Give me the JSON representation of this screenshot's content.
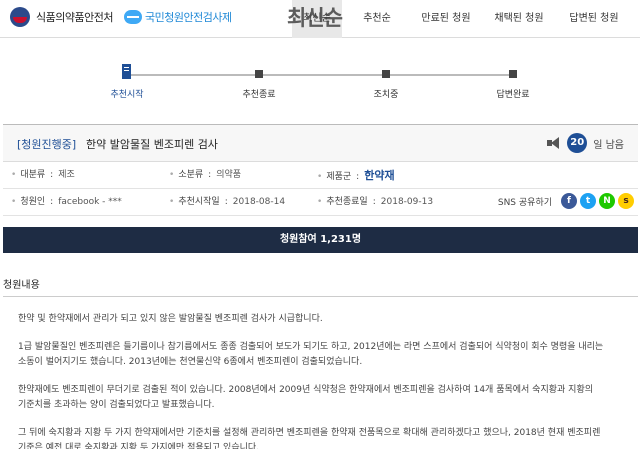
{
  "header": {
    "logo_text": "식품의약품안전처",
    "sub_logo_text": "국민청원안전검사제",
    "overlay_title": "최신순",
    "nav": [
      {
        "label": "최신순",
        "active": true
      },
      {
        "label": "추천순",
        "active": false
      },
      {
        "label": "만료된 청원",
        "active": false
      },
      {
        "label": "채택된 청원",
        "active": false
      },
      {
        "label": "답변된 청원",
        "active": false
      }
    ]
  },
  "progress": {
    "steps": [
      {
        "label": "추천시작",
        "current": true
      },
      {
        "label": "추천종료",
        "current": false
      },
      {
        "label": "조치중",
        "current": false
      },
      {
        "label": "답변완료",
        "current": false
      }
    ]
  },
  "petition": {
    "status": "[청원진행중]",
    "title": "한약 발암물질 벤조피렌 검사",
    "days_count": "20",
    "days_suffix": "일 남음",
    "category_label": "대분류",
    "category_value": "제조",
    "subcategory_label": "소분류",
    "subcategory_value": "의약품",
    "product_label": "제품군",
    "product_value": "한약재",
    "author_label": "청원인",
    "author_value": "facebook - ***",
    "start_label": "추천시작일",
    "start_value": "2018-08-14",
    "end_label": "추천종료일",
    "end_value": "2018-09-13",
    "sns_label": "SNS 공유하기",
    "sns": [
      {
        "name": "facebook-icon",
        "glyph": "f"
      },
      {
        "name": "twitter-icon",
        "glyph": "t"
      },
      {
        "name": "naver-icon",
        "glyph": "N"
      },
      {
        "name": "kakaostory-icon",
        "glyph": "s"
      }
    ],
    "participation_text": "청원참여 1,231명"
  },
  "content": {
    "heading": "청원내용",
    "paragraphs": [
      "한약 및 한약재에서 관리가 되고 있지 않은 발암물질 벤조피렌 검사가 시급합니다.",
      "1급 발암물질인 벤조피렌은 들기름이나 참기름에서도 종종 검출되어 보도가 되기도 하고, 2012년에는 라면 스프에서 검출되어 식약청이 회수 명령을 내리는 소동이 벌어지기도 했습니다. 2013년에는 천연물신약 6종에서 벤조피렌이 검출되었습니다.",
      "한약재에도 벤조피렌이 무더기로 검출된 적이 있습니다. 2008년에서 2009년 식약청은 한약재에서 벤조피렌을 검사하여 14개 품목에서 숙지황과 지황의 기준치를 초과하는 양이 검출되었다고 발표했습니다.",
      "그 뒤에 숙지황과 지황 두 가지 한약재에서만 기준치를 설정해 관리하면 벤조피렌을 한약재 전품목으로 확대해 관리하겠다고 했으나, 2018년 현재 벤조피렌 기준은 예전 대로 숙지황과 지황 두 가지에만 적용되고 있습니다."
    ]
  }
}
